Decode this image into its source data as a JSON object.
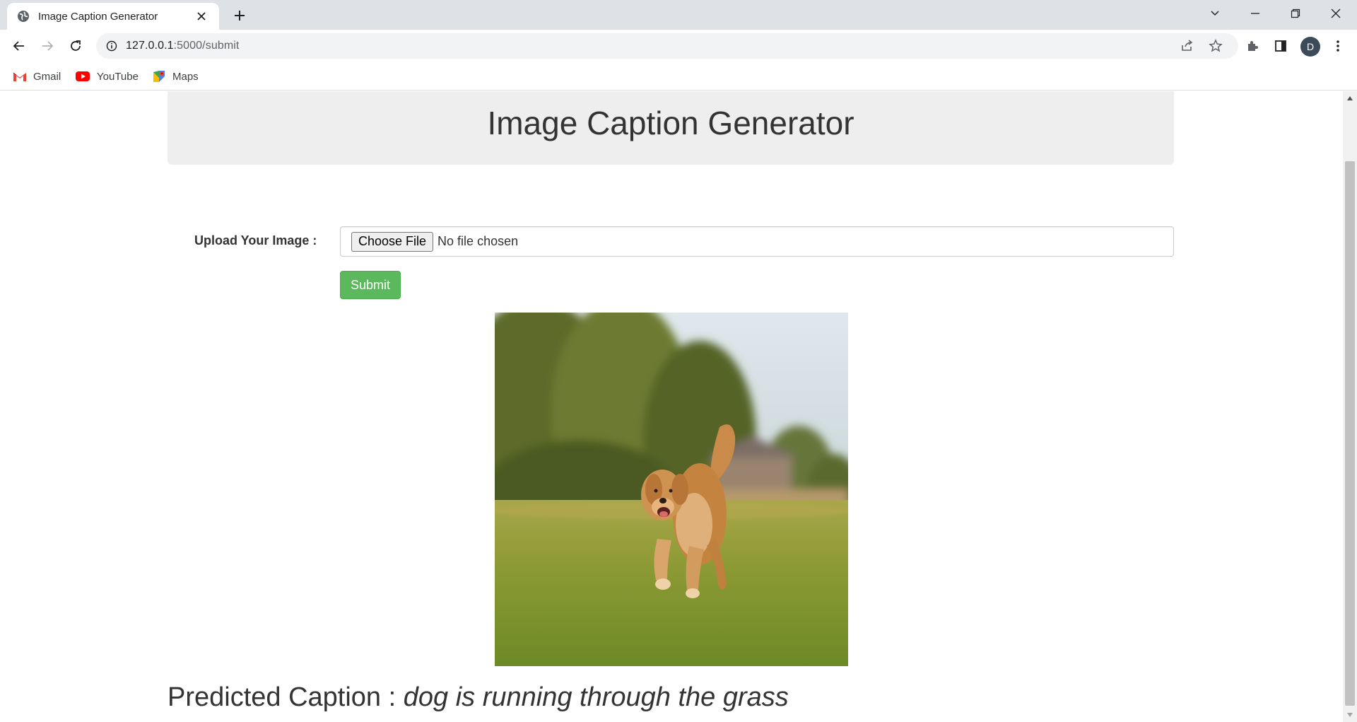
{
  "tab": {
    "title": "Image Caption Generator"
  },
  "window_controls": [
    "chevron-down-icon",
    "minimize-icon",
    "restore-icon",
    "close-icon"
  ],
  "address_bar": {
    "host": "127.0.0.1",
    "path": ":5000/submit"
  },
  "profile": {
    "initial": "D"
  },
  "bookmarks": [
    {
      "label": "Gmail",
      "icon": "gmail-icon"
    },
    {
      "label": "YouTube",
      "icon": "youtube-icon"
    },
    {
      "label": "Maps",
      "icon": "maps-icon"
    }
  ],
  "page": {
    "heading": "Image Caption Generator",
    "upload_label": "Upload Your Image :",
    "choose_file_label": "Choose File",
    "file_status": "No file chosen",
    "submit_label": "Submit",
    "caption_prefix": "Predicted Caption :",
    "caption_text": "dog is running through the grass"
  },
  "colors": {
    "submit_green": "#5cb85c",
    "jumbotron_gray": "#eeeeee",
    "tabbar": "#dee1e6"
  }
}
